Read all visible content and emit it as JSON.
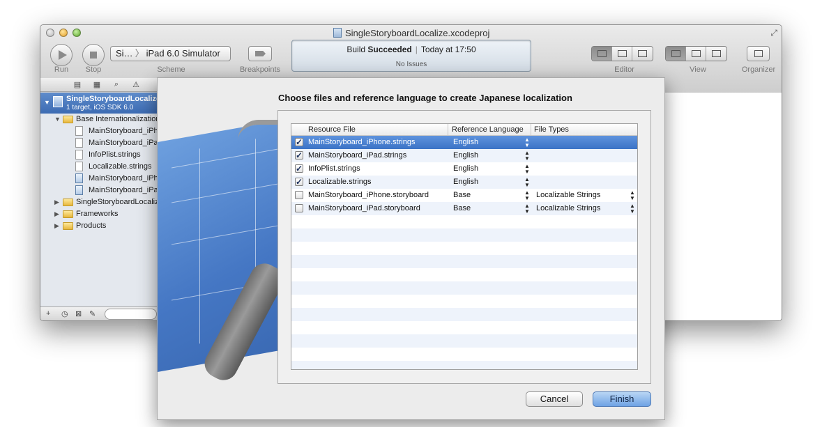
{
  "window": {
    "title": "SingleStoryboardLocalize.xcodeproj"
  },
  "toolbar": {
    "run_label": "Run",
    "stop_label": "Stop",
    "scheme_target": "Si…",
    "scheme_destination": "iPad 6.0 Simulator",
    "scheme_label": "Scheme",
    "breakpoints_label": "Breakpoints",
    "editor_label": "Editor",
    "view_label": "View",
    "organizer_label": "Organizer"
  },
  "activity": {
    "build_prefix": "Build",
    "build_status": "Succeeded",
    "time": "Today at 17:50",
    "issues": "No Issues"
  },
  "navigator": {
    "project_name": "SingleStoryboardLocalize",
    "project_sub": "1 target, iOS SDK 6.0",
    "items": [
      {
        "label": "Base Internationalization",
        "kind": "folder",
        "level": 1,
        "expanded": true
      },
      {
        "label": "MainStoryboard_iPhone.strings",
        "kind": "file",
        "level": 2
      },
      {
        "label": "MainStoryboard_iPad.strings",
        "kind": "file",
        "level": 2
      },
      {
        "label": "InfoPlist.strings",
        "kind": "file",
        "level": 2
      },
      {
        "label": "Localizable.strings",
        "kind": "file",
        "level": 2
      },
      {
        "label": "MainStoryboard_iPhone.storyboard",
        "kind": "storyboard",
        "level": 2
      },
      {
        "label": "MainStoryboard_iPad.storyboard",
        "kind": "storyboard",
        "level": 2
      },
      {
        "label": "SingleStoryboardLocalize",
        "kind": "folder",
        "level": 1,
        "expanded": false
      },
      {
        "label": "Frameworks",
        "kind": "folder",
        "level": 1,
        "expanded": false
      },
      {
        "label": "Products",
        "kind": "folder",
        "level": 1,
        "expanded": false
      }
    ]
  },
  "sheet": {
    "title": "Choose files and reference language to create Japanese localization",
    "columns": [
      "Resource File",
      "Reference Language",
      "File Types"
    ],
    "rows": [
      {
        "checked": true,
        "file": "MainStoryboard_iPhone.strings",
        "language": "English",
        "file_type": "",
        "selected": true
      },
      {
        "checked": true,
        "file": "MainStoryboard_iPad.strings",
        "language": "English",
        "file_type": "",
        "selected": false
      },
      {
        "checked": true,
        "file": "InfoPlist.strings",
        "language": "English",
        "file_type": "",
        "selected": false
      },
      {
        "checked": true,
        "file": "Localizable.strings",
        "language": "English",
        "file_type": "",
        "selected": false
      },
      {
        "checked": false,
        "file": "MainStoryboard_iPhone.storyboard",
        "language": "Base",
        "file_type": "Localizable Strings",
        "selected": false
      },
      {
        "checked": false,
        "file": "MainStoryboard_iPad.storyboard",
        "language": "Base",
        "file_type": "Localizable Strings",
        "selected": false
      }
    ],
    "cancel_label": "Cancel",
    "finish_label": "Finish"
  },
  "colors": {
    "selection": "#3b73c6",
    "default_button": "#6ea2e4",
    "row_alt": "#eef3fb"
  }
}
